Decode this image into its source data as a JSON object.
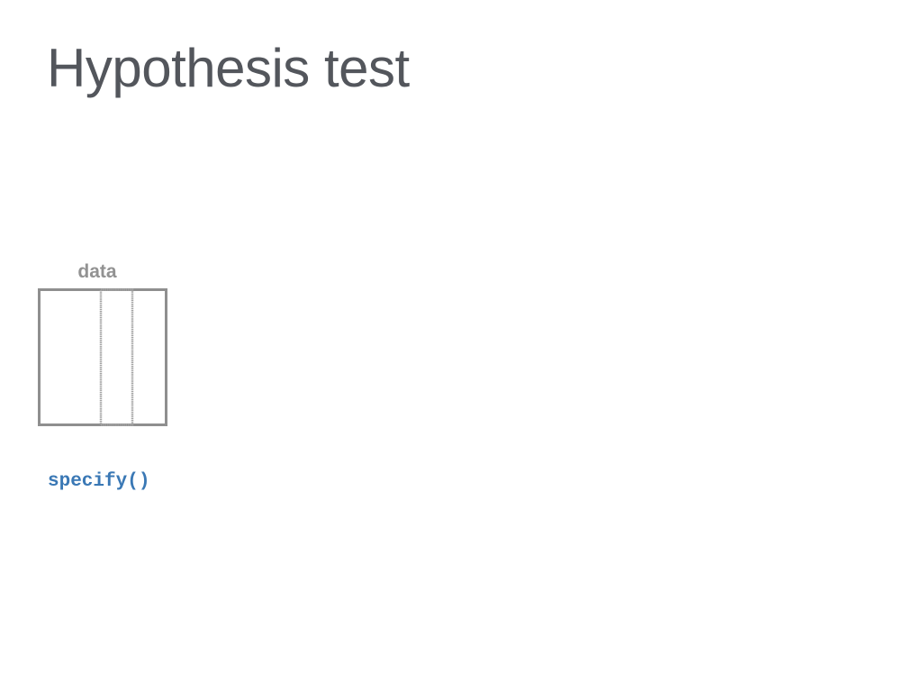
{
  "slide": {
    "title": "Hypothesis test"
  },
  "diagram": {
    "data_label": "data",
    "box_color": "#8f8f8f",
    "column_color": "#a3a3a3"
  },
  "code": {
    "function_call": "specify()",
    "color": "#3a78b5"
  }
}
